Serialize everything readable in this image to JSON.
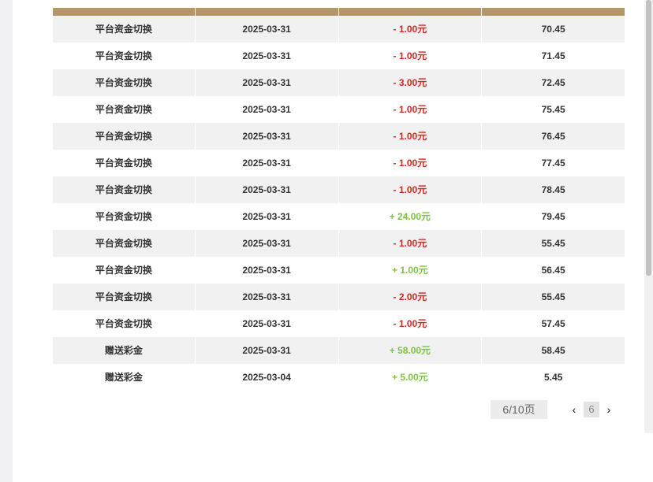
{
  "table": {
    "rows": [
      {
        "type": "平台资金切换",
        "date": "2025-03-31",
        "amount": "- 1.00元",
        "sign": "neg",
        "balance": "70.45"
      },
      {
        "type": "平台资金切换",
        "date": "2025-03-31",
        "amount": "- 1.00元",
        "sign": "neg",
        "balance": "71.45"
      },
      {
        "type": "平台资金切换",
        "date": "2025-03-31",
        "amount": "- 3.00元",
        "sign": "neg",
        "balance": "72.45"
      },
      {
        "type": "平台资金切换",
        "date": "2025-03-31",
        "amount": "- 1.00元",
        "sign": "neg",
        "balance": "75.45"
      },
      {
        "type": "平台资金切换",
        "date": "2025-03-31",
        "amount": "- 1.00元",
        "sign": "neg",
        "balance": "76.45"
      },
      {
        "type": "平台资金切换",
        "date": "2025-03-31",
        "amount": "- 1.00元",
        "sign": "neg",
        "balance": "77.45"
      },
      {
        "type": "平台资金切换",
        "date": "2025-03-31",
        "amount": "- 1.00元",
        "sign": "neg",
        "balance": "78.45"
      },
      {
        "type": "平台资金切换",
        "date": "2025-03-31",
        "amount": "+ 24.00元",
        "sign": "pos",
        "balance": "79.45"
      },
      {
        "type": "平台资金切换",
        "date": "2025-03-31",
        "amount": "- 1.00元",
        "sign": "neg",
        "balance": "55.45"
      },
      {
        "type": "平台资金切换",
        "date": "2025-03-31",
        "amount": "+ 1.00元",
        "sign": "pos",
        "balance": "56.45"
      },
      {
        "type": "平台资金切换",
        "date": "2025-03-31",
        "amount": "- 2.00元",
        "sign": "neg",
        "balance": "55.45"
      },
      {
        "type": "平台资金切换",
        "date": "2025-03-31",
        "amount": "- 1.00元",
        "sign": "neg",
        "balance": "57.45"
      },
      {
        "type": "赠送彩金",
        "date": "2025-03-31",
        "amount": "+ 58.00元",
        "sign": "pos",
        "balance": "58.45"
      },
      {
        "type": "赠送彩金",
        "date": "2025-03-04",
        "amount": "+ 5.00元",
        "sign": "pos",
        "balance": "5.45"
      }
    ]
  },
  "pagination": {
    "info": "6/10页",
    "prev_icon": "‹",
    "current": "6",
    "next_icon": "›"
  },
  "colors": {
    "header": "#b69566",
    "negative": "#e02020",
    "positive": "#7fc241"
  }
}
